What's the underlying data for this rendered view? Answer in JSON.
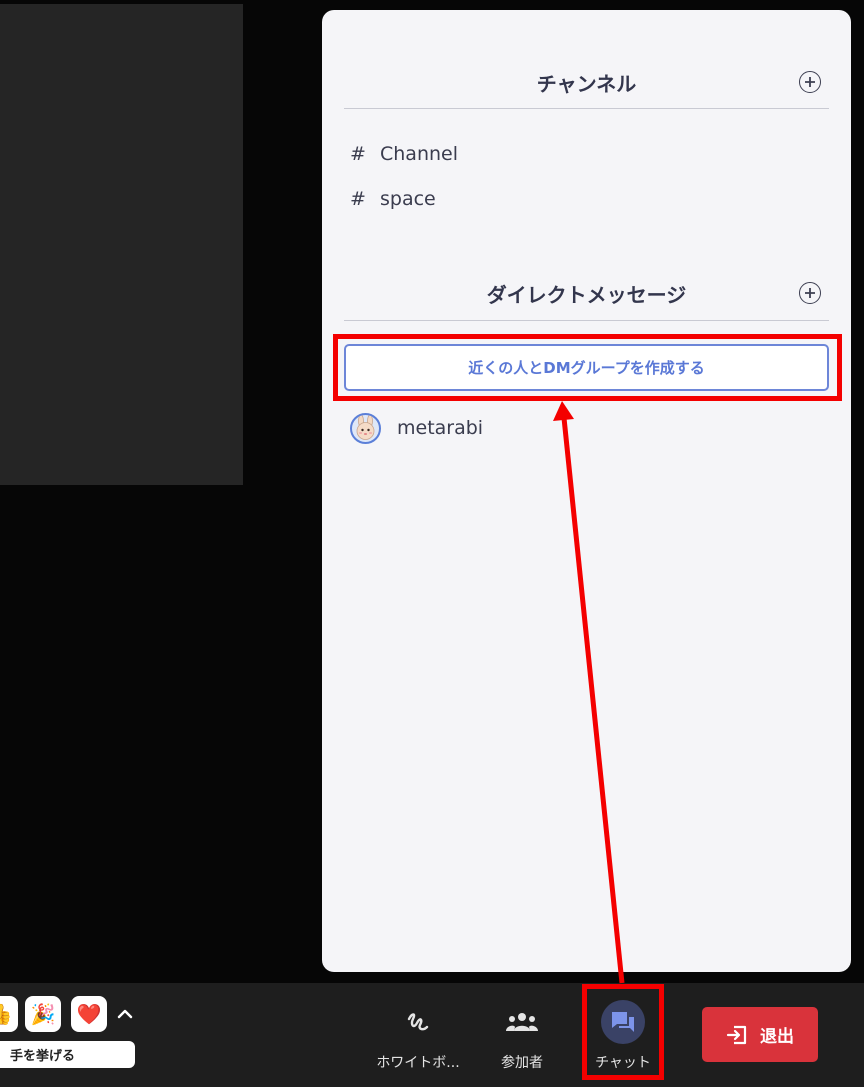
{
  "sidebar": {
    "channels_title": "チャンネル",
    "channels": [
      {
        "prefix": "#",
        "name": "Channel"
      },
      {
        "prefix": "#",
        "name": "space"
      }
    ],
    "dm_title": "ダイレクトメッセージ",
    "create_dm_button": "近くの人とDMグループを作成する",
    "dms": [
      {
        "name": "metarabi",
        "avatar": "rabbit-avatar-icon"
      }
    ]
  },
  "bottom_bar": {
    "reactions": [
      "thumbs-up-icon",
      "party-popper-icon",
      "heart-icon"
    ],
    "reaction_glyphs": [
      "👍",
      "🎉",
      "❤️"
    ],
    "raise_hand_label": "手を挙げる",
    "whiteboard_label": "ホワイトボ...",
    "participants_label": "参加者",
    "chat_label": "チャット",
    "leave_label": "退出"
  },
  "colors": {
    "highlight": "#f40000",
    "accent_blue": "#5a78d6",
    "leave_red": "#d9333b",
    "panel_bg": "#f5f5f8"
  }
}
